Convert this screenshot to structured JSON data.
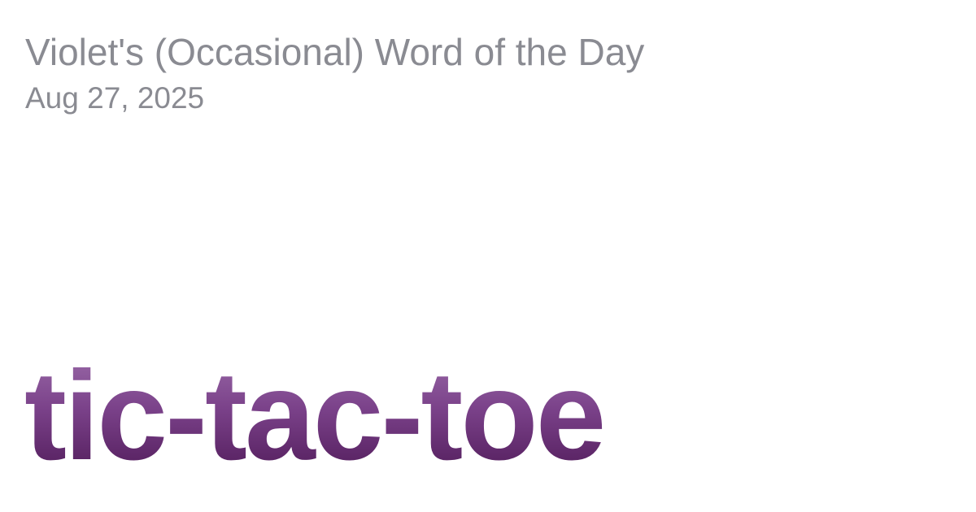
{
  "header": {
    "site_title": "Violet's (Occasional) Word of the Day",
    "date": "Aug 27, 2025"
  },
  "main": {
    "word": "tic-tac-toe"
  },
  "colors": {
    "background": "#ffffff",
    "muted_text": "#8a8b92",
    "word_gradient_top": "#9a6aa8",
    "word_gradient_bottom": "#4f1a58"
  }
}
